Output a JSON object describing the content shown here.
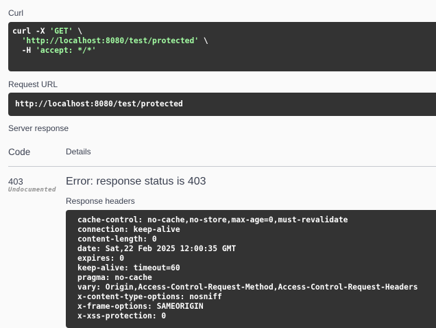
{
  "curl": {
    "label": "Curl",
    "line1": {
      "cmd": "curl -X ",
      "method": "'GET'",
      "tail": " \\"
    },
    "line2": {
      "indent": "  ",
      "url": "'http://localhost:8080/test/protected'",
      "tail": " \\"
    },
    "line3": {
      "indent": "  -H ",
      "header": "'accept: */*'"
    }
  },
  "request_url": {
    "label": "Request URL",
    "value": "http://localhost:8080/test/protected"
  },
  "server_response": {
    "label": "Server response",
    "columns": {
      "code": "Code",
      "details": "Details"
    },
    "status_code": "403",
    "status_note": "Undocumented",
    "error_title": "Error: response status is 403",
    "headers_label": "Response headers",
    "headers": [
      "cache-control: no-cache,no-store,max-age=0,must-revalidate",
      "connection: keep-alive",
      "content-length: 0",
      "date: Sat,22 Feb 2025 12:00:35 GMT",
      "expires: 0",
      "keep-alive: timeout=60",
      "pragma: no-cache",
      "vary: Origin,Access-Control-Request-Method,Access-Control-Request-Headers",
      "x-content-type-options: nosniff",
      "x-frame-options: SAMEORIGIN",
      "x-xss-protection: 0"
    ]
  },
  "colors": {
    "code_bg": "#333333",
    "string": "#a2fca2",
    "text": "#3b4151"
  }
}
